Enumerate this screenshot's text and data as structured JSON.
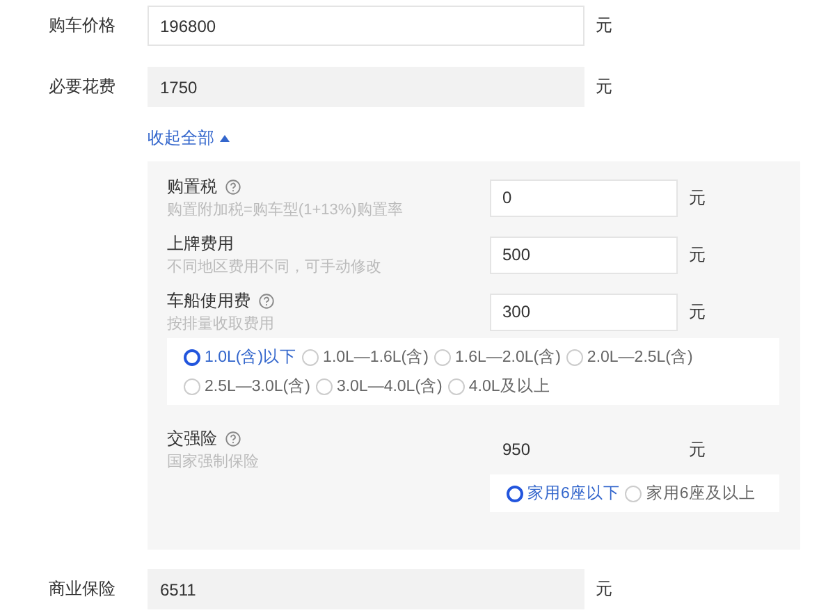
{
  "rows_top": [
    {
      "label": "购车价格",
      "value": "196800",
      "unit": "元",
      "readonly": false
    },
    {
      "label": "必要花费",
      "value": "1750",
      "unit": "元",
      "readonly": true
    }
  ],
  "toggle": {
    "label": "收起全部",
    "expanded": true
  },
  "details": [
    {
      "label": "购置税",
      "help": true,
      "hint": "购置附加税=购车型(1+13%)购置率",
      "value": "0",
      "unit": "元",
      "readonly": false
    },
    {
      "label": "上牌费用",
      "help": false,
      "hint": "不同地区费用不同，可手动修改",
      "value": "500",
      "unit": "元",
      "readonly": false
    },
    {
      "label": "车船使用费",
      "help": true,
      "hint": "按排量收取费用",
      "value": "300",
      "unit": "元",
      "readonly": false,
      "options": [
        {
          "label": "1.0L(含)以下",
          "selected": true
        },
        {
          "label": "1.0L—1.6L(含)",
          "selected": false
        },
        {
          "label": "1.6L—2.0L(含)",
          "selected": false
        },
        {
          "label": "2.0L—2.5L(含)",
          "selected": false
        },
        {
          "label": "2.5L—3.0L(含)",
          "selected": false
        },
        {
          "label": "3.0L—4.0L(含)",
          "selected": false
        },
        {
          "label": "4.0L及以上",
          "selected": false
        }
      ]
    },
    {
      "label": "交强险",
      "help": true,
      "hint": "国家强制保险",
      "value": "950",
      "unit": "元",
      "readonly": true,
      "seat_options": [
        {
          "label": "家用6座以下",
          "selected": true
        },
        {
          "label": "家用6座及以上",
          "selected": false
        }
      ]
    }
  ],
  "rows_bottom": [
    {
      "label": "商业保险",
      "value": "6511",
      "unit": "元",
      "readonly": true
    }
  ]
}
